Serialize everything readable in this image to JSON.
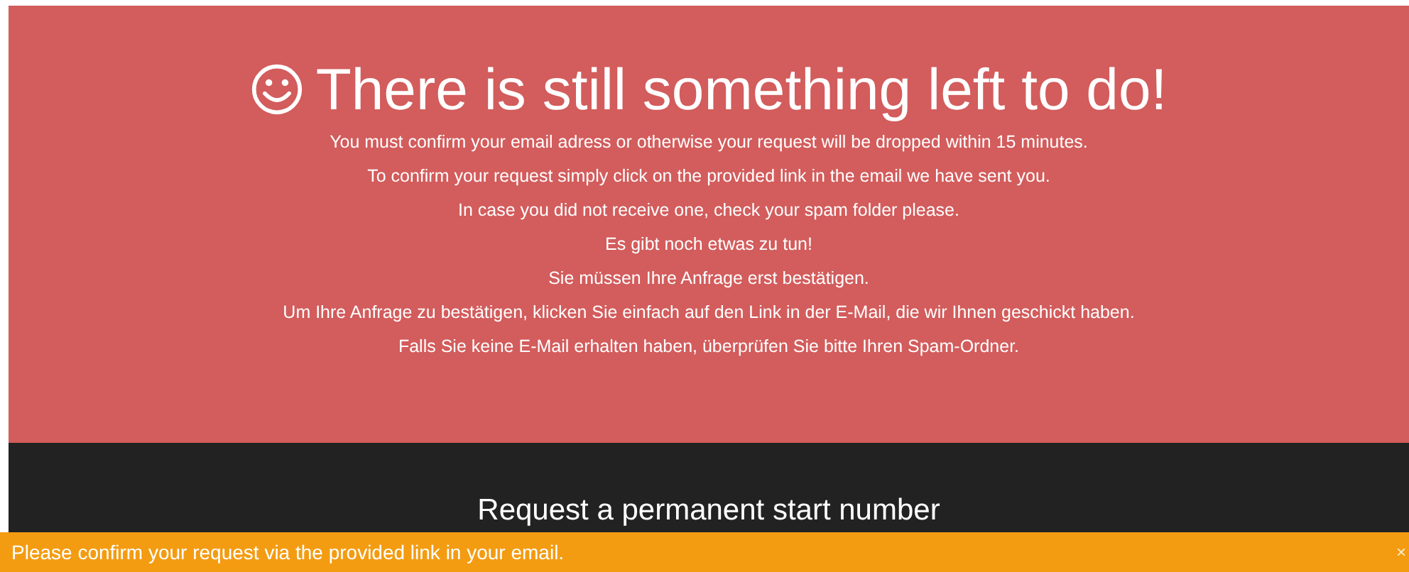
{
  "notice": {
    "title": "There is still something left to do!",
    "lines": [
      "You must confirm your email adress or otherwise your request will be dropped within 15 minutes.",
      "To confirm your request simply click on the provided link in the email we have sent you.",
      "In case you did not receive one, check your spam folder please.",
      "Es gibt noch etwas zu tun!",
      "Sie müssen Ihre Anfrage erst bestätigen.",
      "Um Ihre Anfrage zu bestätigen, klicken Sie einfach auf den Link in der E-Mail, die wir Ihnen geschickt haben.",
      "Falls Sie keine E-Mail erhalten haben, überprüfen Sie bitte Ihren Spam-Ordner."
    ]
  },
  "section": {
    "title": "Request a permanent start number"
  },
  "alert_bar": {
    "message": "Please confirm your request via the provided link in your email.",
    "close": "×"
  }
}
